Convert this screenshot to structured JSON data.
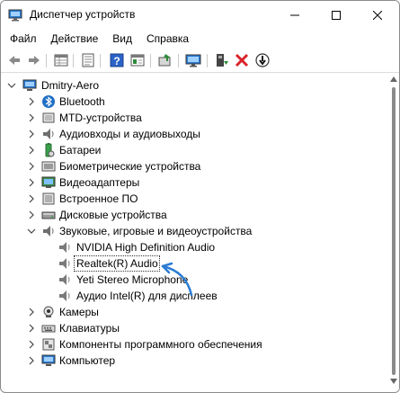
{
  "window": {
    "title": "Диспетчер устройств"
  },
  "menu": [
    "Файл",
    "Действие",
    "Вид",
    "Справка"
  ],
  "toolbar_icons": [
    "back-arrow-icon",
    "forward-arrow-icon",
    "properties-grid-icon",
    "properties-sheet-icon",
    "help-icon",
    "view-grid-icon",
    "scan-hardware-icon",
    "monitor-icon",
    "update-driver-icon",
    "remove-device-icon",
    "disable-device-icon"
  ],
  "tree": {
    "root": "Dmitry-Aero",
    "categories": [
      {
        "label": "Bluetooth",
        "icon": "bluetooth-icon"
      },
      {
        "label": "MTD-устройства",
        "icon": "mtd-device-icon"
      },
      {
        "label": "Аудиовходы и аудиовыходы",
        "icon": "speaker-icon"
      },
      {
        "label": "Батареи",
        "icon": "battery-icon"
      },
      {
        "label": "Биометрические устройства",
        "icon": "biometric-icon"
      },
      {
        "label": "Видеоадаптеры",
        "icon": "display-adapter-icon"
      },
      {
        "label": "Встроенное ПО",
        "icon": "firmware-icon"
      },
      {
        "label": "Дисковые устройства",
        "icon": "disk-drive-icon"
      },
      {
        "label": "Звуковые, игровые и видеоустройства",
        "icon": "speaker-icon",
        "expanded": true
      }
    ],
    "sound_children": [
      {
        "label": "NVIDIA High Definition Audio"
      },
      {
        "label": "Realtek(R) Audio",
        "selected": true
      },
      {
        "label": "Yeti Stereo Microphone"
      },
      {
        "label": "Аудио Intel(R) для дисплеев"
      }
    ],
    "more_categories": [
      {
        "label": "Камеры",
        "icon": "camera-icon"
      },
      {
        "label": "Клавиатуры",
        "icon": "keyboard-icon"
      },
      {
        "label": "Компоненты программного обеспечения",
        "icon": "software-component-icon"
      },
      {
        "label": "Компьютер",
        "icon": "computer-icon"
      }
    ]
  },
  "colors": {
    "accent_blue": "#2b7cd3",
    "red": "#d9232a",
    "green": "#2e8b3a"
  }
}
